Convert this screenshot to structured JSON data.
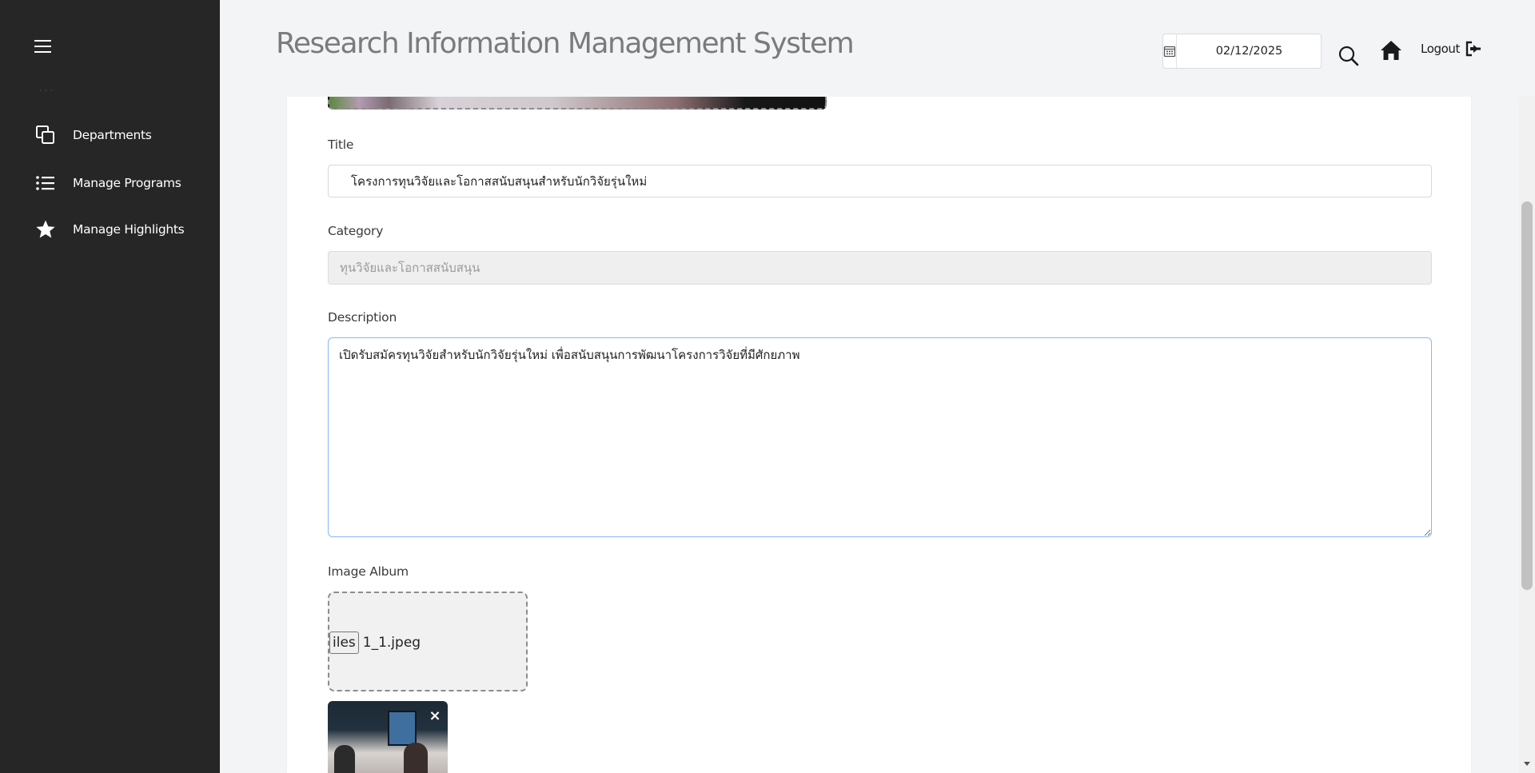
{
  "header": {
    "title": "Research Information Management System",
    "date_value": "02/12/2025",
    "logout_label": "Logout"
  },
  "sidebar": {
    "items": [
      {
        "label": "Departments",
        "icon": "copy-stack-icon"
      },
      {
        "label": "Manage Programs",
        "icon": "list-icon"
      },
      {
        "label": "Manage Highlights",
        "icon": "star-icon"
      }
    ]
  },
  "form": {
    "title_label": "Title",
    "title_value": "โครงการทุนวิจัยและโอกาสสนับสนุนสำหรับนักวิจัยรุ่นใหม่",
    "category_label": "Category",
    "category_value": "ทุนวิจัยและโอกาสสนับสนุน",
    "description_label": "Description",
    "description_value": "เปิดรับสมัครทุนวิจัยสำหรับนักวิจัยรุ่นใหม่ เพื่อสนับสนุนการพัฒนาโครงการวิจัยที่มีศักยภาพ",
    "album_label": "Image Album",
    "file_button_label": "iles",
    "file_name": "1_1.jpeg",
    "remove_label": "×"
  },
  "colors": {
    "sidebar_bg": "#262626",
    "page_bg": "#f3f4f6",
    "focus_border": "#86b7fe"
  }
}
